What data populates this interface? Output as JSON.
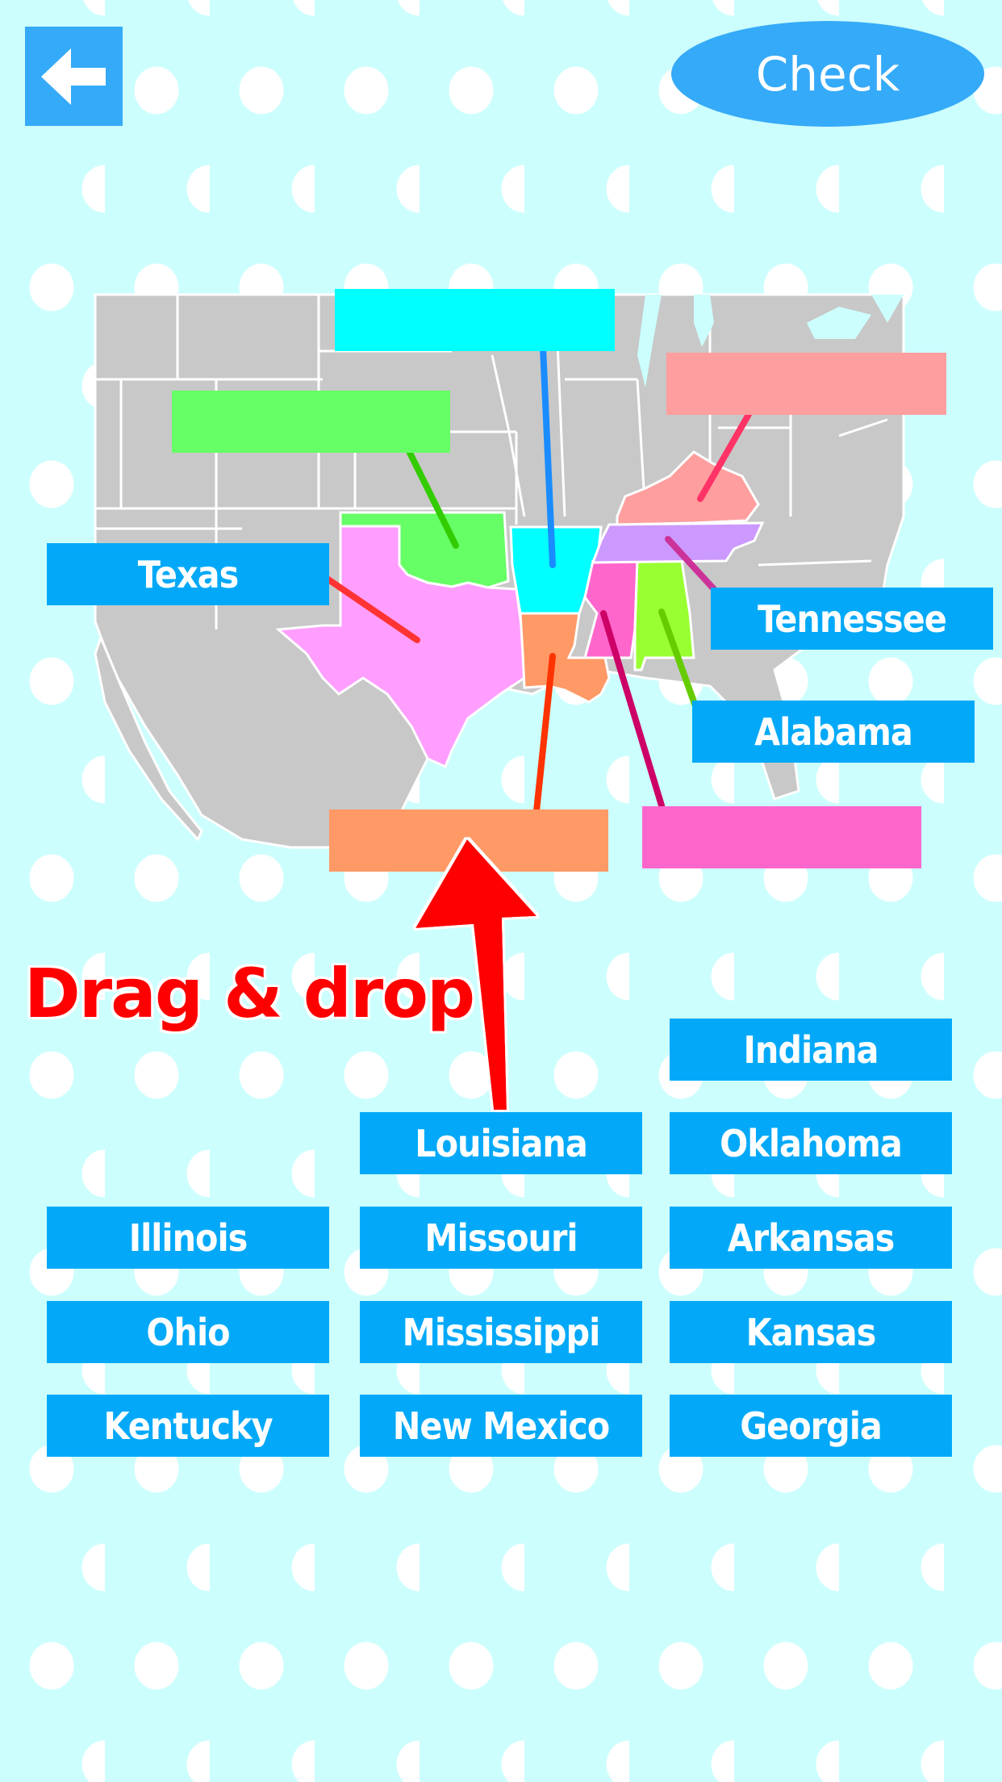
{
  "header": {
    "back_icon": "arrow-left-icon",
    "check_label": "Check"
  },
  "map": {
    "region": "South-central United States",
    "highlighted_states": [
      {
        "state_key": "missouri-area",
        "color": "#00ffff",
        "line_color": "#1a8cff"
      },
      {
        "state_key": "oklahoma",
        "color": "#66ff66",
        "line_color": "#33cc00"
      },
      {
        "state_key": "kentucky",
        "color": "#ff9e9e",
        "line_color": "#ff3366"
      },
      {
        "state_key": "texas",
        "color": "#ff9eff",
        "line_color": "#ff3333"
      },
      {
        "state_key": "arkansas",
        "color": "#00ffff",
        "line_color": "#1a8cff"
      },
      {
        "state_key": "tennessee",
        "color": "#cc99ff",
        "line_color": "#cc3399"
      },
      {
        "state_key": "mississippi",
        "color": "#ff66cc",
        "line_color": "#cc0066"
      },
      {
        "state_key": "alabama",
        "color": "#99ff33",
        "line_color": "#66cc00"
      },
      {
        "state_key": "louisiana",
        "color": "#ff9966",
        "line_color": "#ff3300"
      }
    ],
    "base_color": "#c8c8c8",
    "border_color": "#ffffff"
  },
  "targets": [
    {
      "id": "cyan-target",
      "label": "",
      "color": "#00ffff"
    },
    {
      "id": "green-target",
      "label": "",
      "color": "#66ff66"
    },
    {
      "id": "salmon-target",
      "label": "",
      "color": "#ff9e9e"
    },
    {
      "id": "texas-target",
      "label": "Texas",
      "color": "#03a9f8"
    },
    {
      "id": "tennessee-target",
      "label": "Tennessee",
      "color": "#03a9f8"
    },
    {
      "id": "alabama-target",
      "label": "Alabama",
      "color": "#03a9f8"
    },
    {
      "id": "orange-target",
      "label": "",
      "color": "#ff9966"
    },
    {
      "id": "pink-target",
      "label": "",
      "color": "#ff66cc"
    }
  ],
  "hint": {
    "text": "Drag & drop",
    "color": "#ff0000"
  },
  "choices": [
    {
      "label": "Indiana"
    },
    {
      "label": "Louisiana"
    },
    {
      "label": "Oklahoma"
    },
    {
      "label": "Illinois"
    },
    {
      "label": "Missouri"
    },
    {
      "label": "Arkansas"
    },
    {
      "label": "Ohio"
    },
    {
      "label": "Mississippi"
    },
    {
      "label": "Kansas"
    },
    {
      "label": "Kentucky"
    },
    {
      "label": "New Mexico"
    },
    {
      "label": "Georgia"
    }
  ]
}
